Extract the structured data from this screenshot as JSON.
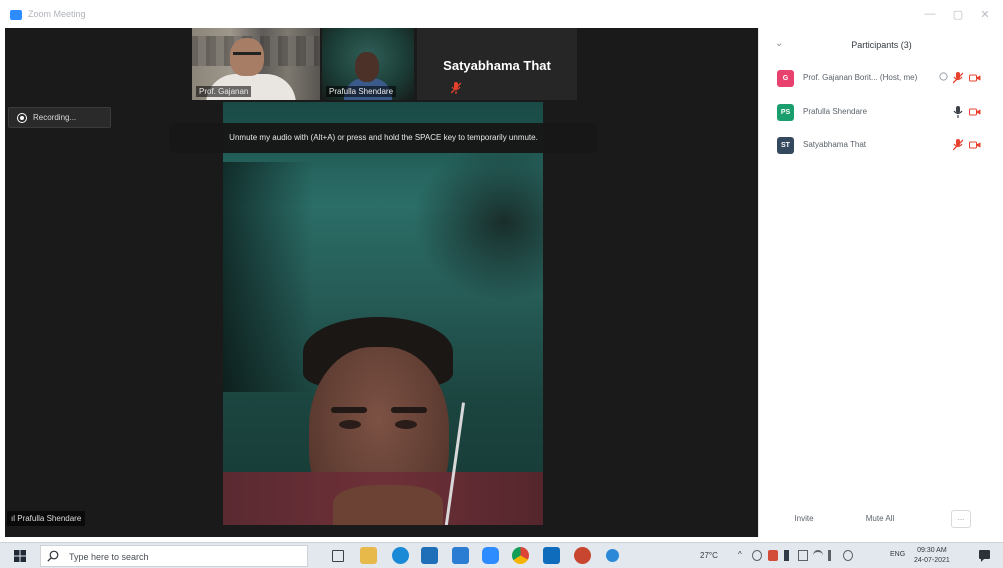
{
  "window": {
    "title": "Zoom Meeting",
    "controls": [
      "—",
      "▢",
      "✕"
    ]
  },
  "meeting": {
    "gallery_strip": [
      {
        "name": "Prof. Gajanan"
      },
      {
        "name": "Prafulla Shendare"
      },
      {
        "name": "Satyabhama That",
        "muted": true
      }
    ],
    "recording_label": "Recording...",
    "unmute_tip": "Unmute my audio with (Alt+A) or press and hold the SPACE key to temporarily unmute.",
    "active_speaker_name": "Prafulla Shendare"
  },
  "participants_panel": {
    "collapse_icon": "⌄",
    "title": "Participants (3)",
    "participants": [
      {
        "initials": "G",
        "name": "Prof. Gajanan Borit... (Host, me)",
        "avatar_color": "#e8416e",
        "mic": "muted",
        "video": "off",
        "more": true
      },
      {
        "initials": "PS",
        "name": "Prafulla Shendare",
        "avatar_color": "#1a9e6e",
        "mic": "on",
        "video": "off",
        "more": false
      },
      {
        "initials": "ST",
        "name": "Satyabhama That",
        "avatar_color": "#34495e",
        "mic": "muted",
        "video": "off",
        "more": false
      }
    ],
    "buttons": {
      "invite": "Invite",
      "mute_all": "Mute All",
      "more": "..."
    }
  },
  "taskbar": {
    "search_placeholder": "Type here to search",
    "apps": [
      "task-view",
      "file-explorer",
      "edge",
      "store",
      "office",
      "zoom",
      "chrome",
      "outlook",
      "powerpoint",
      "help"
    ],
    "weather": "27°C",
    "language": "ENG",
    "time": "09:30 AM",
    "date": "24-07-2021"
  },
  "colors": {
    "meeting_bg": "#1a1a1a",
    "accent": "#2d8cff",
    "mute_red": "#e8412d"
  }
}
